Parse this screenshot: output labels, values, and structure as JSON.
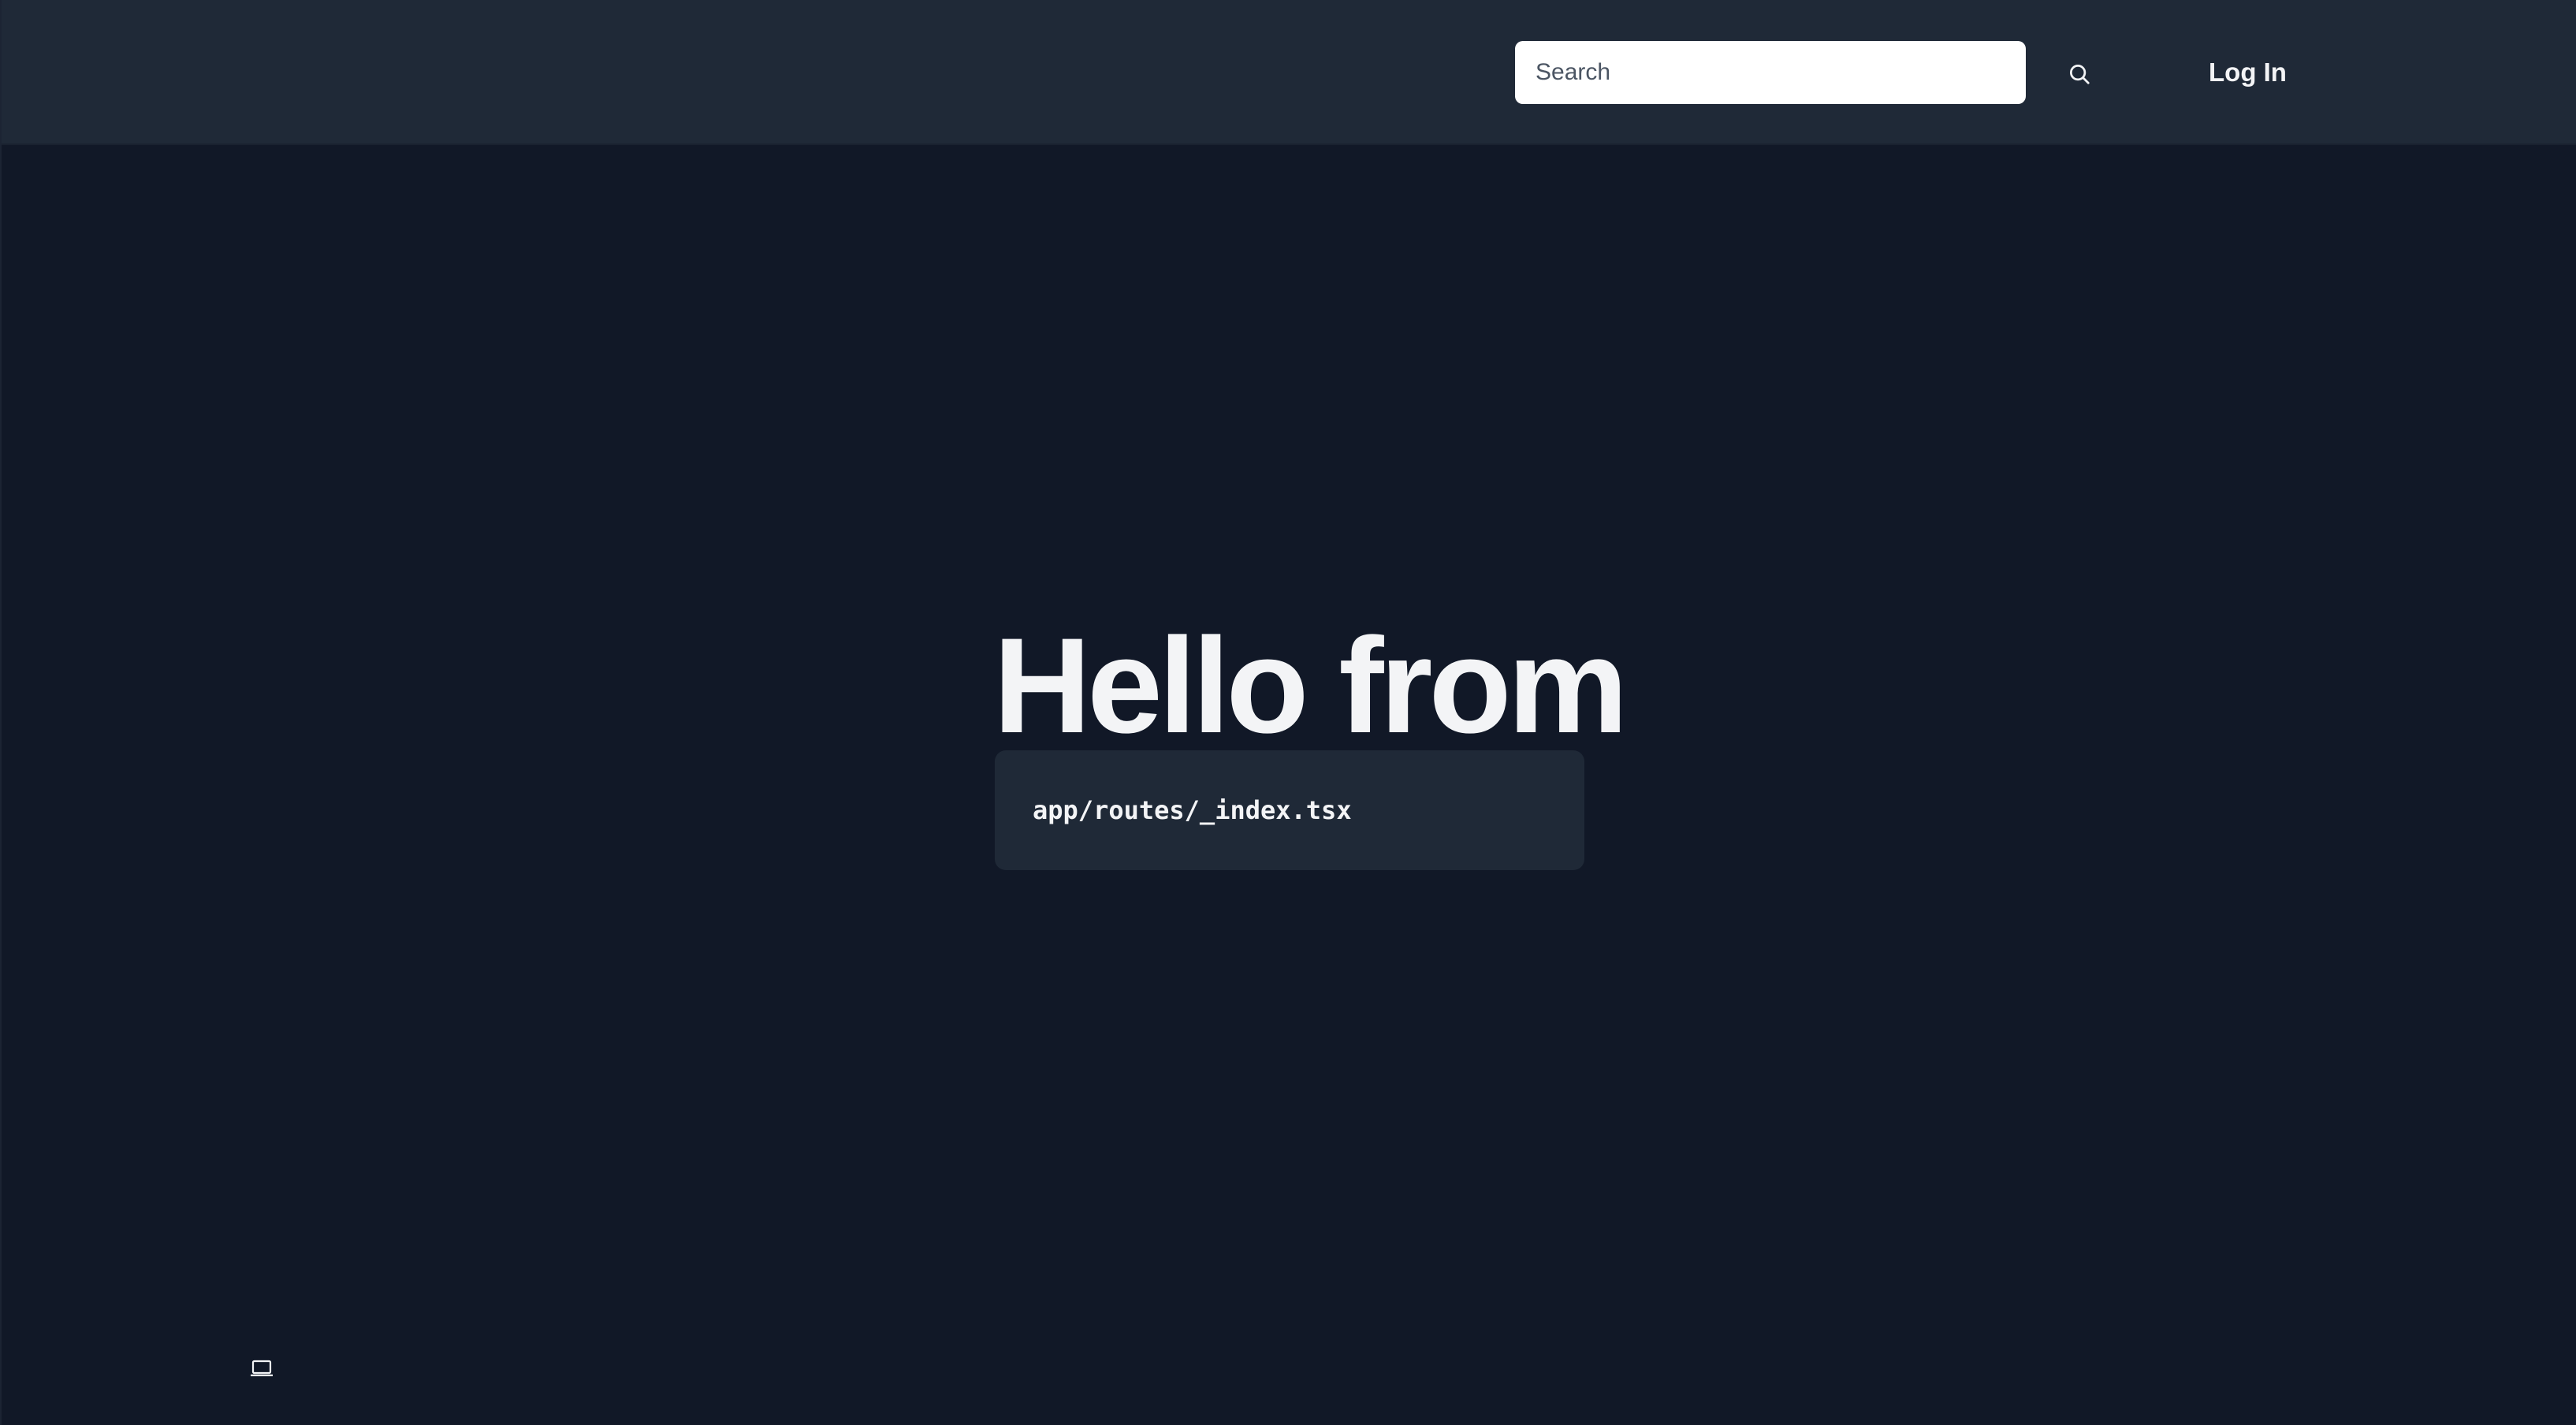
{
  "header": {
    "search": {
      "placeholder": "Search",
      "value": "",
      "icon": "search-icon"
    },
    "login_label": "Log In"
  },
  "main": {
    "title": "Hello from",
    "code_path": "app/routes/_index.tsx"
  },
  "footer": {
    "device_icon": "laptop-icon"
  },
  "colors": {
    "background": "#111827",
    "header_background": "#1f2937",
    "code_background": "#1f2937",
    "text": "#f3f4f6"
  }
}
